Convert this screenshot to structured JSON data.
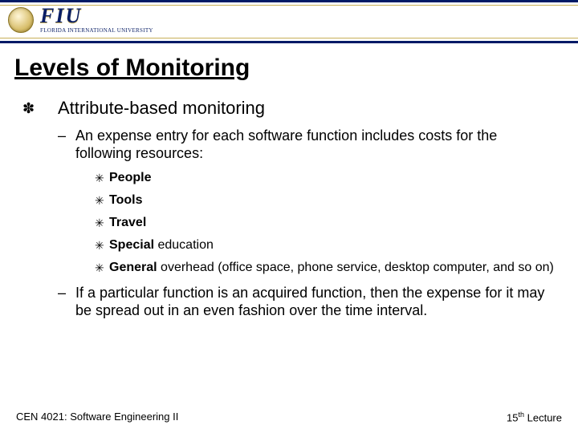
{
  "header": {
    "logo_text": "FIU",
    "logo_sub": "FLORIDA INTERNATIONAL UNIVERSITY"
  },
  "title": "Levels of Monitoring",
  "content": {
    "lvl1_text": "Attribute-based monitoring",
    "lvl2a_text": "An expense entry for each software function includes costs for the following resources:",
    "resources": {
      "r0": {
        "bold": "People",
        "rest": ""
      },
      "r1": {
        "bold": "Tools",
        "rest": ""
      },
      "r2": {
        "bold": "Travel",
        "rest": ""
      },
      "r3": {
        "bold": "Special",
        "rest": " education"
      },
      "r4": {
        "bold": "General",
        "rest": " overhead (office space, phone service, desktop computer, and so on)"
      }
    },
    "lvl2b_text": "If a particular function is an acquired function, then the expense for it may be spread out in an even fashion over the time interval."
  },
  "footer": {
    "left": "CEN 4021: Software Engineering II",
    "right_num": "15",
    "right_sup": "th",
    "right_word": " Lecture"
  }
}
